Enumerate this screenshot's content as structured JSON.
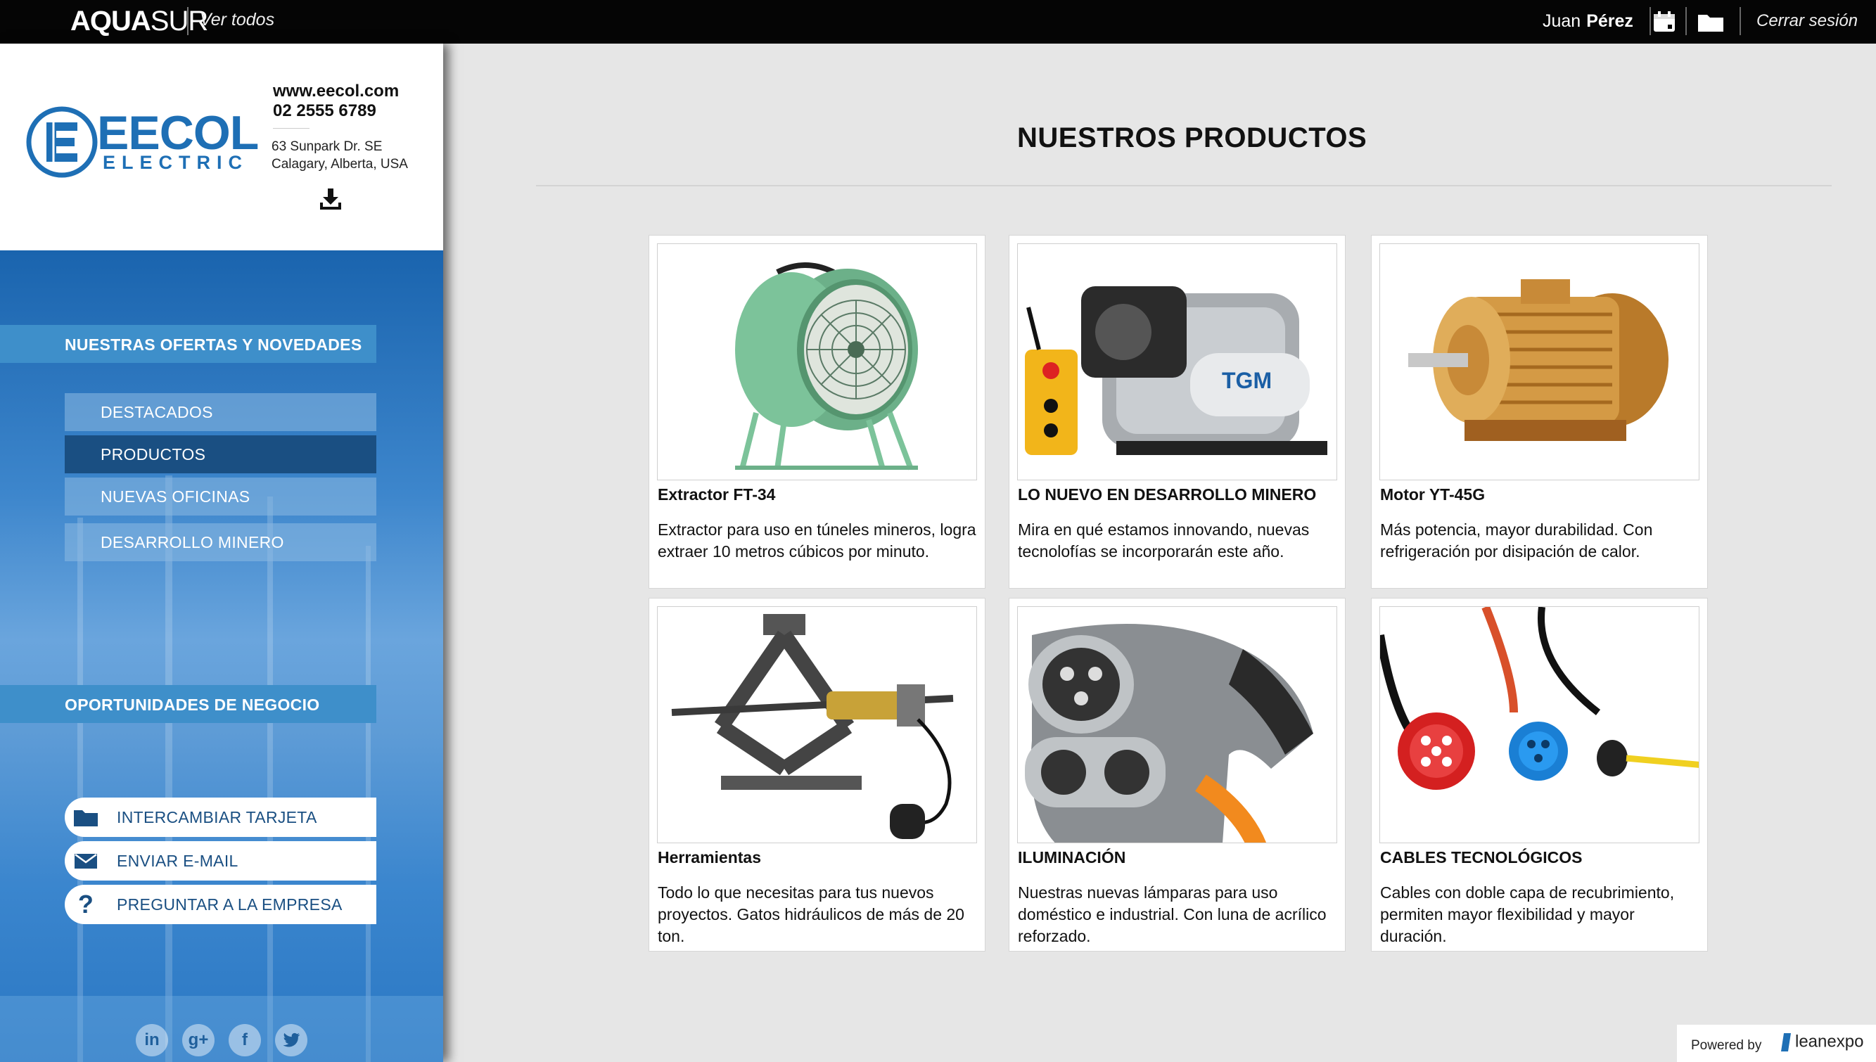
{
  "topbar": {
    "brand_bold": "AQUA",
    "brand_light": "SUR",
    "ver_todos": "Ver todos",
    "user_first": "Juan",
    "user_last": "Pérez",
    "logout": "Cerrar sesión",
    "icons": [
      "calendar-icon",
      "folder-icon"
    ]
  },
  "company": {
    "logo_main": "EECOL",
    "logo_sub": "ELECTRIC",
    "website": "www.eecol.com",
    "phone": "02 2555 6789",
    "address_line1": "63 Sunpark Dr. SE",
    "address_line2": "Calagary, Alberta, USA",
    "download_icon": "download-icon"
  },
  "sidebar": {
    "section_offers": "NUESTRAS OFERTAS Y NOVEDADES",
    "items": [
      {
        "label": "DESTACADOS",
        "active": false
      },
      {
        "label": "PRODUCTOS",
        "active": true
      },
      {
        "label": "NUEVAS OFICINAS",
        "active": false
      },
      {
        "label": "DESARROLLO MINERO",
        "active": false
      }
    ],
    "section_business": "OPORTUNIDADES DE NEGOCIO",
    "actions": [
      {
        "label": "INTERCAMBIAR TARJETA",
        "icon": "card-icon"
      },
      {
        "label": "ENVIAR E-MAIL",
        "icon": "mail-icon"
      },
      {
        "label": "PREGUNTAR A LA EMPRESA",
        "icon": "question-icon"
      }
    ],
    "social": [
      "linkedin-icon",
      "google-plus-icon",
      "facebook-icon",
      "twitter-icon"
    ]
  },
  "main": {
    "title": "NUESTROS PRODUCTOS",
    "products": [
      {
        "title": "Extractor FT-34",
        "desc": "Extractor para uso en túneles mineros, logra extraer 10 metros cúbicos por minuto."
      },
      {
        "title": "LO NUEVO EN DESARROLLO MINERO",
        "desc": "Mira en qué estamos innovando, nuevas tecnolofías se incorporarán este año."
      },
      {
        "title": "Motor YT-45G",
        "desc": "Más potencia, mayor durabilidad. Con refrigeración por disipación de calor."
      },
      {
        "title": "Herramientas",
        "desc": "Todo lo que necesitas para tus nuevos proyectos. Gatos hidráulicos de más de 20 ton."
      },
      {
        "title": "ILUMINACIÓN",
        "desc": "Nuestras nuevas lámparas para uso doméstico e industrial. Con luna de acrílico reforzado."
      },
      {
        "title": "CABLES TECNOLÓGICOS",
        "desc": "Cables con doble capa de recubrimiento, permiten mayor flexibilidad y mayor duración."
      }
    ],
    "product_images": [
      "fan-extractor-image",
      "hoist-motor-image",
      "electric-motor-image",
      "hydraulic-jack-image",
      "charging-connector-image",
      "industrial-cables-image"
    ]
  },
  "footer": {
    "powered_by": "Powered by",
    "brand": "leanexpo"
  },
  "colors": {
    "topbar": "#050505",
    "sidebar_blue": "#3e8fca",
    "active_item": "#1a4f82",
    "eecol_blue": "#1e6fb5"
  }
}
